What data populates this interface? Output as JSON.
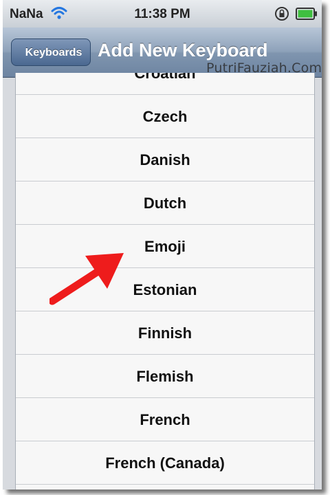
{
  "status_bar": {
    "carrier": "NaNa",
    "time": "11:38 PM",
    "icons": [
      "wifi-icon",
      "rotation-lock-icon",
      "battery-icon"
    ]
  },
  "nav": {
    "back_label": "Keyboards",
    "title": "Add New Keyboard"
  },
  "watermark": "PutriFauziah.Com",
  "keyboards": [
    "Croatian",
    "Czech",
    "Danish",
    "Dutch",
    "Emoji",
    "Estonian",
    "Finnish",
    "Flemish",
    "French",
    "French (Canada)"
  ],
  "annotation": {
    "arrow_color": "#ee1c1c",
    "points_to": "Emoji"
  }
}
